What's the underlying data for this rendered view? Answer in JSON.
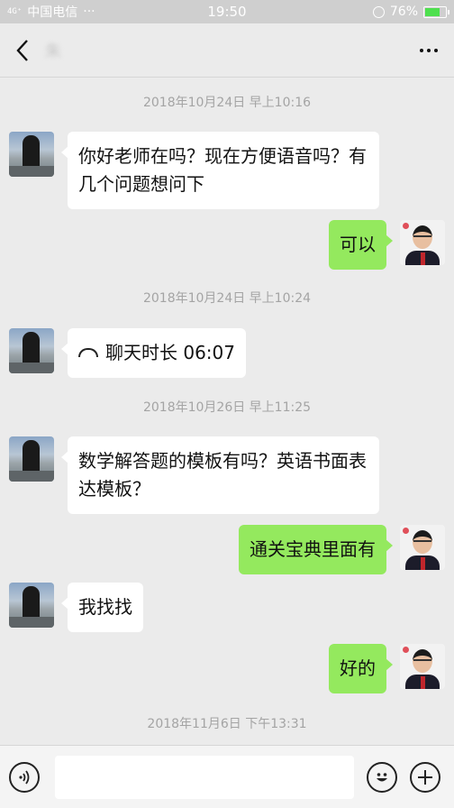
{
  "status_bar": {
    "signal": "4G⁺",
    "carrier": "中国电信",
    "dots": "···",
    "time": "19:50",
    "battery": "76%",
    "battery_level": 0.76
  },
  "header": {
    "title": "朱"
  },
  "messages": [
    {
      "type": "timestamp",
      "text": "2018年10月24日 早上10:16"
    },
    {
      "type": "incoming",
      "text": "你好老师在吗？现在方便语音吗？有几个问题想问下"
    },
    {
      "type": "outgoing",
      "text": "可以"
    },
    {
      "type": "timestamp",
      "text": "2018年10月24日 早上10:24"
    },
    {
      "type": "incoming_call",
      "text": "聊天时长 06:07"
    },
    {
      "type": "timestamp",
      "text": "2018年10月26日 早上11:25"
    },
    {
      "type": "incoming",
      "text": "数学解答题的模板有吗？英语书面表达模板？"
    },
    {
      "type": "outgoing",
      "text": "通关宝典里面有"
    },
    {
      "type": "incoming",
      "text": "我找找"
    },
    {
      "type": "outgoing",
      "text": "好的"
    },
    {
      "type": "timestamp",
      "text": "2018年11月6日 下午13:31"
    }
  ],
  "input": {
    "value": "",
    "placeholder": ""
  }
}
